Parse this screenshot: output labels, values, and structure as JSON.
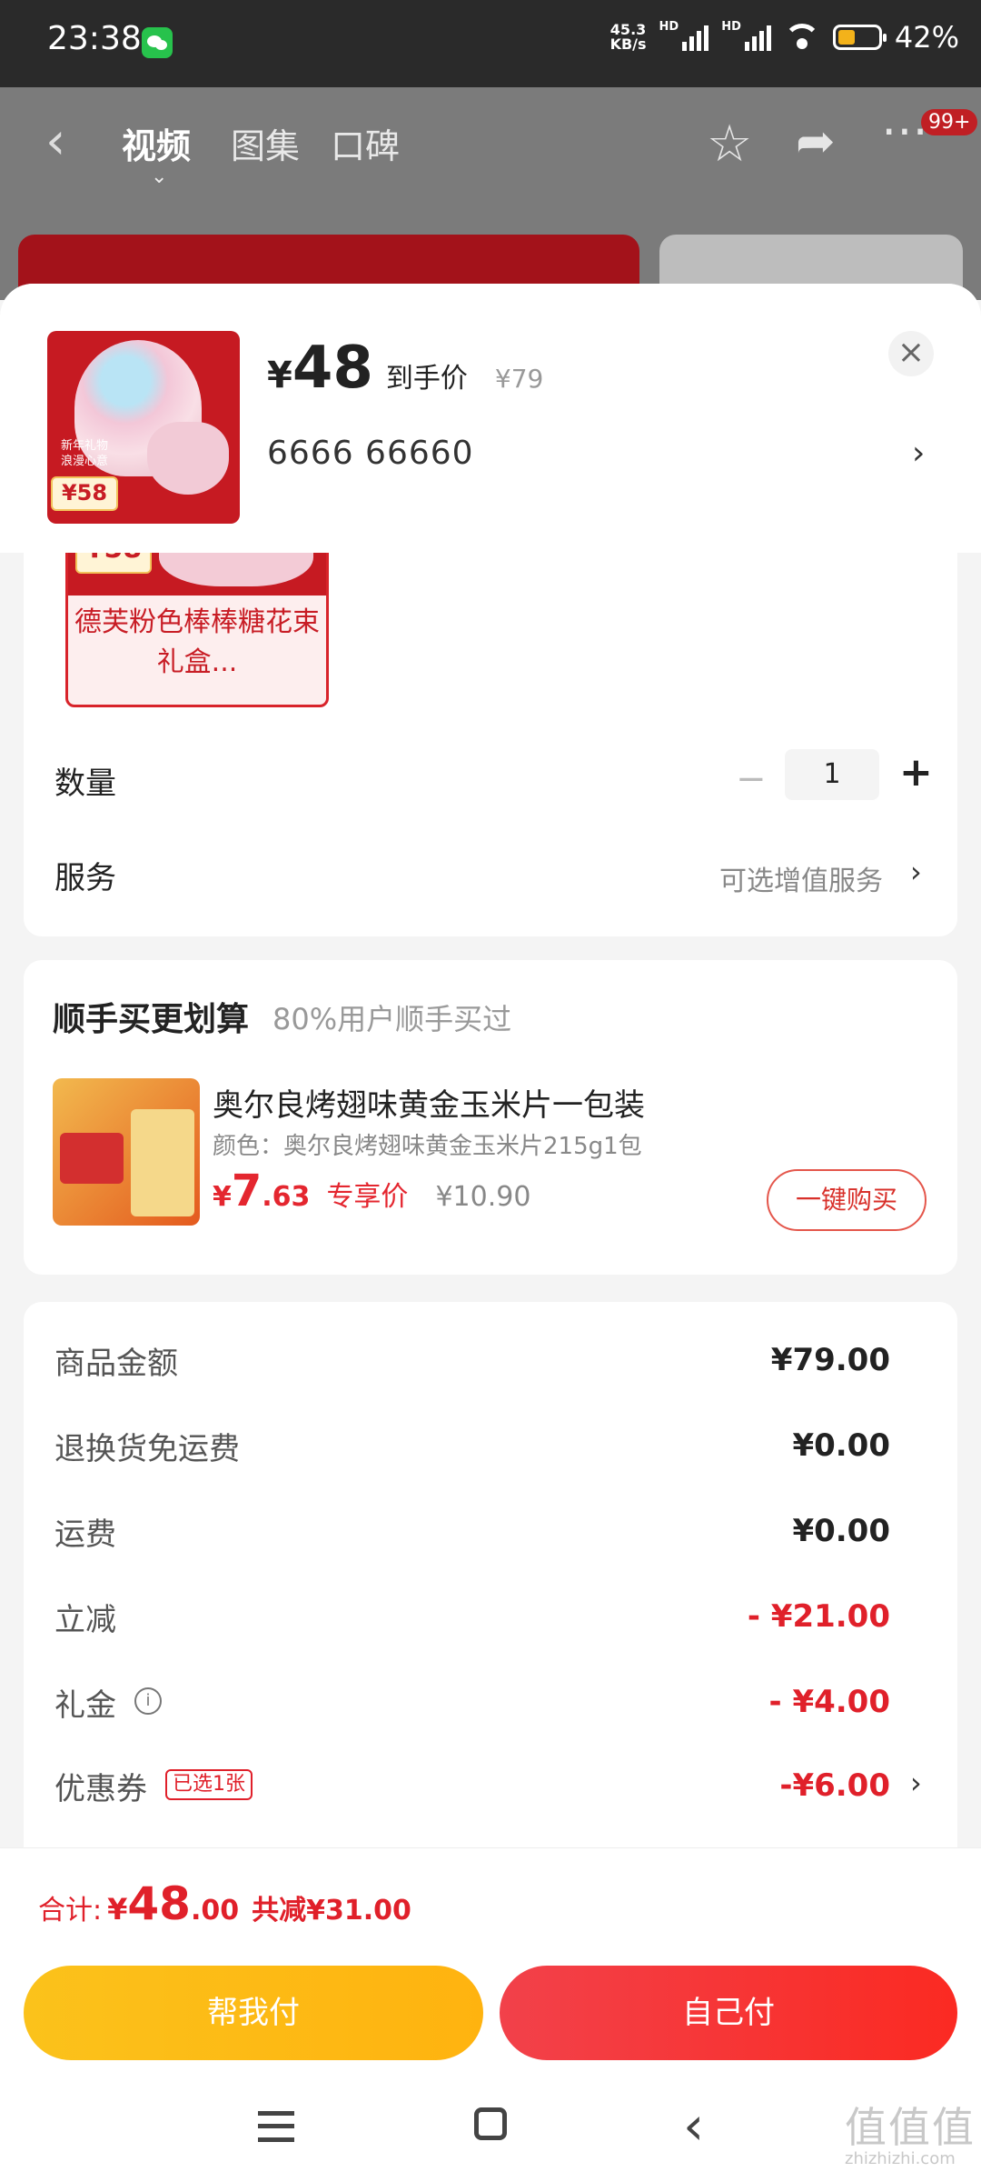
{
  "status_bar": {
    "time": "23:38",
    "net_speed_value": "45.3",
    "net_speed_unit": "KB/s",
    "hd1": "HD",
    "hd2": "HD",
    "battery_percent": 42,
    "battery_text": "42%"
  },
  "top_nav": {
    "tabs": [
      {
        "label": "视频"
      },
      {
        "label": "图集"
      },
      {
        "label": "口碑"
      }
    ],
    "badge": "99+"
  },
  "product": {
    "currency": "¥",
    "price": "48",
    "price_label": "到手价",
    "original_price": "¥79",
    "spec": "6666  66660",
    "thumb_tag": "新年礼物\n浪漫心意",
    "thumb_price": "¥58"
  },
  "options": {
    "variant": {
      "price": "¥58",
      "name": "德芙粉色棒棒糖花束 礼盒..."
    },
    "quantity_label": "数量",
    "quantity_value": "1",
    "minus": "−",
    "plus": "+",
    "service_label": "服务",
    "service_value": "可选增值服务"
  },
  "bundle": {
    "title": "顺手买更划算",
    "subtitle": "80%用户顺手买过",
    "item_name": "奥尔良烤翅味黄金玉米片一包装",
    "item_color": "颜色：奥尔良烤翅味黄金玉米片215g1包",
    "price_currency": "¥",
    "price_int": "7",
    "price_dec": ".63",
    "price_label": "专享价",
    "original_price": "¥10.90",
    "buy_button": "一键购买"
  },
  "summary": {
    "rows": [
      {
        "label": "商品金额",
        "value": "¥79.00"
      },
      {
        "label": "退换货免运费",
        "value": "¥0.00"
      },
      {
        "label": "运费",
        "value": "¥0.00"
      },
      {
        "label": "立减",
        "value": "- ¥21.00"
      },
      {
        "label": "礼金",
        "value": "- ¥4.00"
      },
      {
        "label": "优惠券",
        "value": "-¥6.00"
      }
    ],
    "coupon_badge": "已选1张"
  },
  "total": {
    "label": "合计:",
    "currency": "¥",
    "int": "48",
    "dec": ".00",
    "saved": "共减¥31.00"
  },
  "actions": {
    "pay_for_me": "帮我付",
    "pay_self": "自己付"
  },
  "watermark": {
    "logo": "值值值",
    "url": "zhizhizhi.com"
  },
  "colors": {
    "accent_red": "#e0202a",
    "accent_yellow": "#fbc21b",
    "friend_pay": "#ffb30f",
    "self_pay": "#f2414a"
  }
}
